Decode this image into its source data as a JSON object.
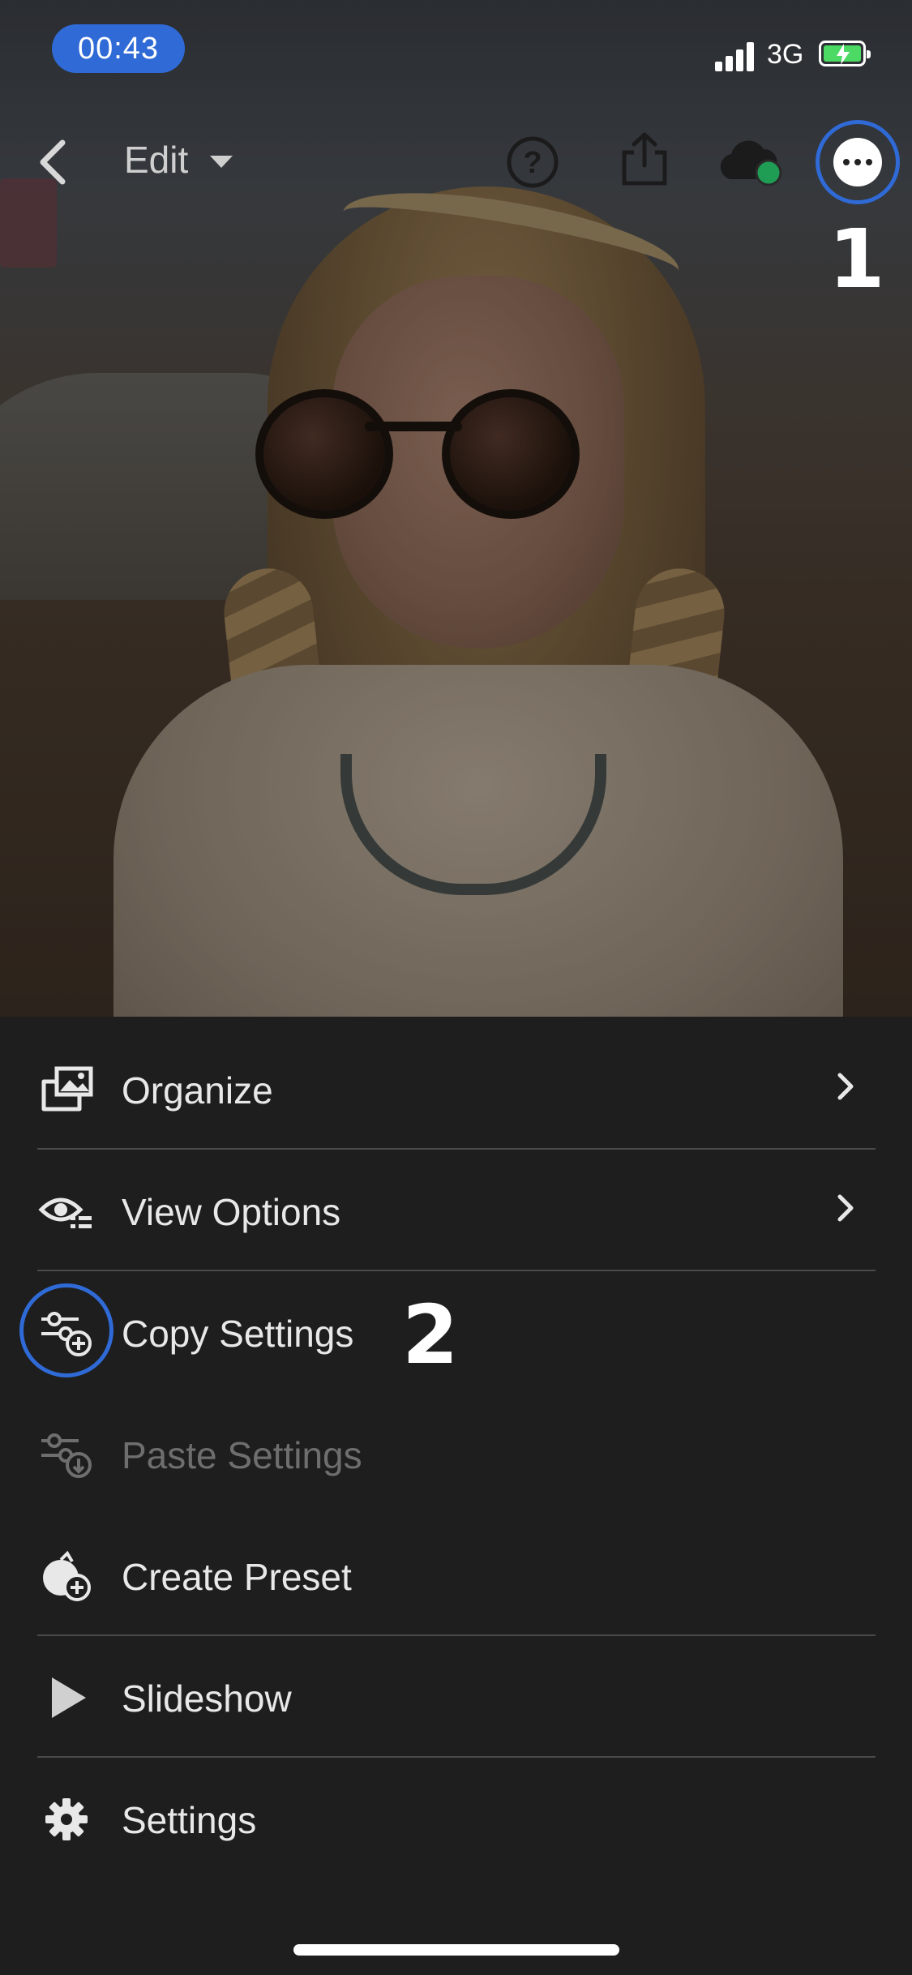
{
  "status_bar": {
    "time": "00:43",
    "network": "3G"
  },
  "toolbar": {
    "edit_label": "Edit"
  },
  "annotations": {
    "step1": "1",
    "step2": "2"
  },
  "menu": {
    "items": [
      {
        "label": "Organize",
        "icon": "organize-folder-icon",
        "has_chevron": true
      },
      {
        "label": "View Options",
        "icon": "view-options-eye-icon",
        "has_chevron": true
      },
      {
        "label": "Copy Settings",
        "icon": "copy-settings-icon"
      },
      {
        "label": "Paste Settings",
        "icon": "paste-settings-icon",
        "disabled": true
      },
      {
        "label": "Create Preset",
        "icon": "create-preset-icon"
      },
      {
        "label": "Slideshow",
        "icon": "play-icon"
      },
      {
        "label": "Settings",
        "icon": "gear-icon"
      }
    ]
  },
  "colors": {
    "accent": "#2f6ad6",
    "menu_bg": "#1e1e1e",
    "divider": "#4a4a4a",
    "sync_dot": "#1f9d55"
  }
}
